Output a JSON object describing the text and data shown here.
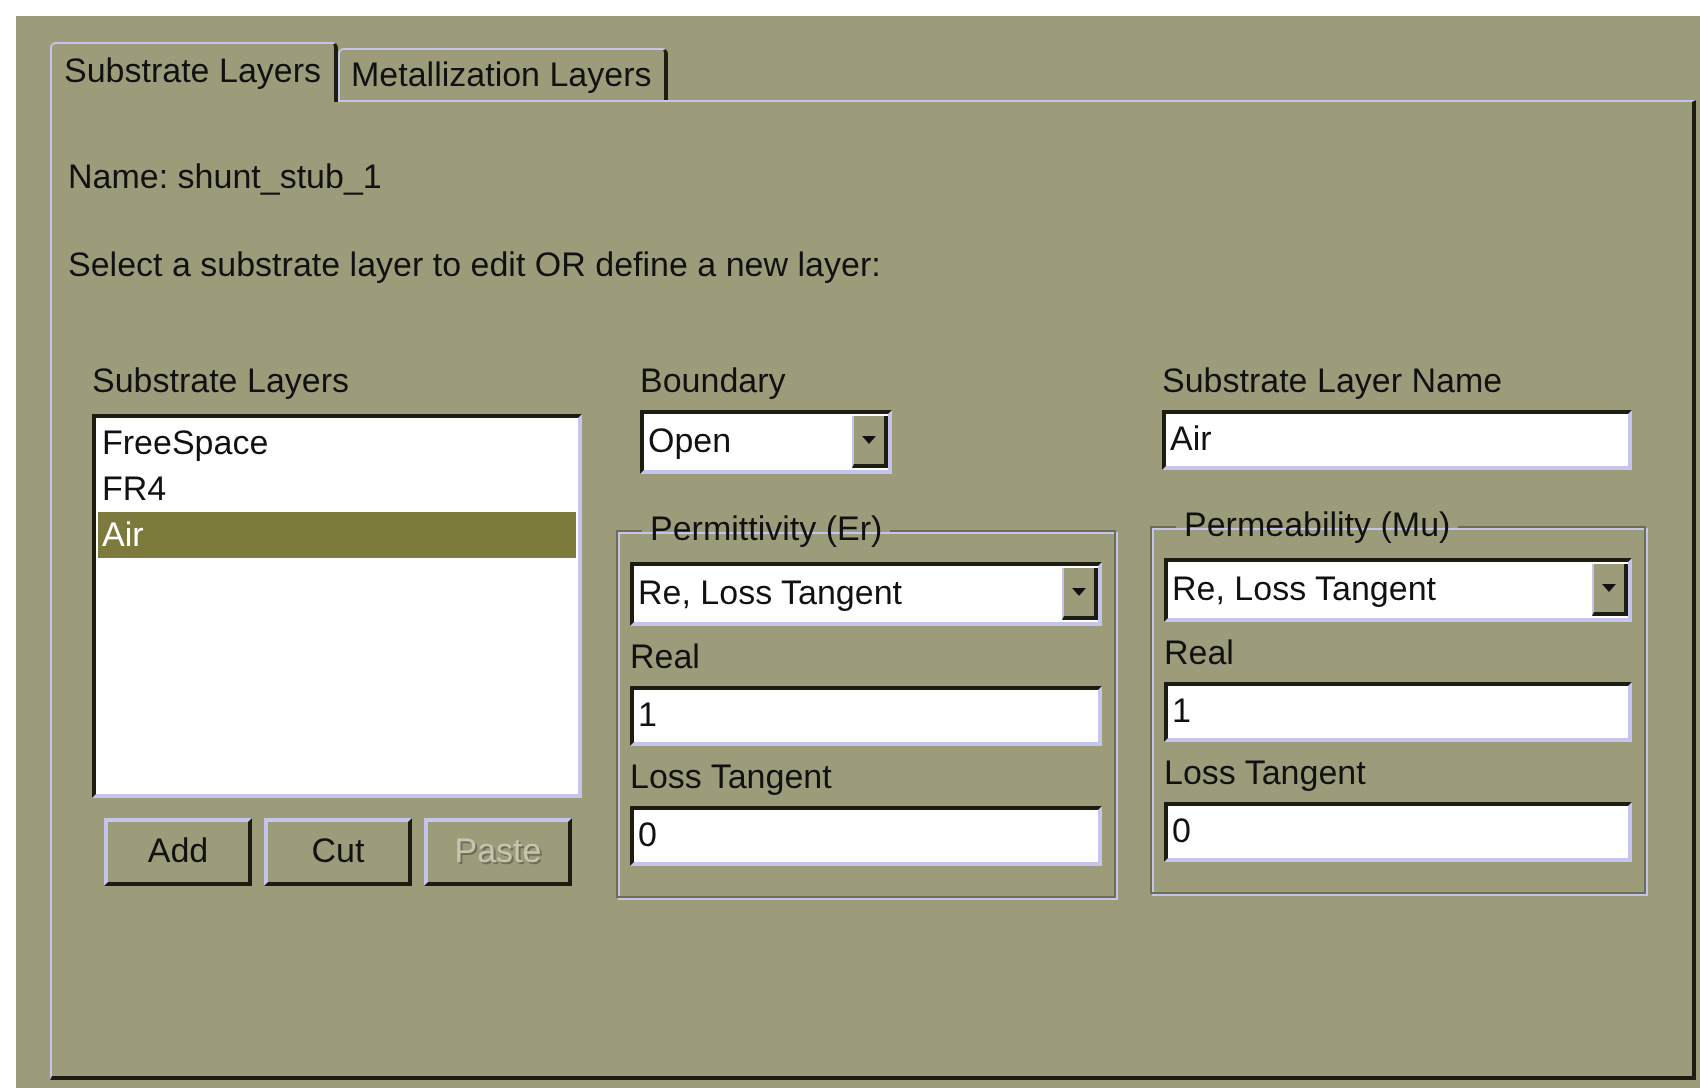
{
  "tabs": [
    {
      "label": "Substrate Layers",
      "selected": true
    },
    {
      "label": "Metallization Layers",
      "selected": false
    }
  ],
  "name_label": "Name: shunt_stub_1",
  "instruction": "Select a substrate layer to edit OR define a new layer:",
  "layers": {
    "label": "Substrate Layers",
    "items": [
      {
        "label": "FreeSpace",
        "selected": false
      },
      {
        "label": "FR4",
        "selected": false
      },
      {
        "label": "Air",
        "selected": true
      }
    ],
    "buttons": [
      {
        "label": "Add",
        "disabled": false
      },
      {
        "label": "Cut",
        "disabled": false
      },
      {
        "label": "Paste",
        "disabled": true
      }
    ]
  },
  "boundary": {
    "label": "Boundary",
    "value": "Open"
  },
  "layer_name": {
    "label": "Substrate Layer Name",
    "value": "Air"
  },
  "groups": [
    {
      "title": "Permittivity (Er)",
      "mode": "Re, Loss Tangent",
      "real_label": "Real",
      "real": "1",
      "loss_label": "Loss Tangent",
      "loss": "0"
    },
    {
      "title": "Permeability (Mu)",
      "mode": "Re, Loss Tangent",
      "real_label": "Real",
      "real": "1",
      "loss_label": "Loss Tangent",
      "loss": "0"
    }
  ]
}
